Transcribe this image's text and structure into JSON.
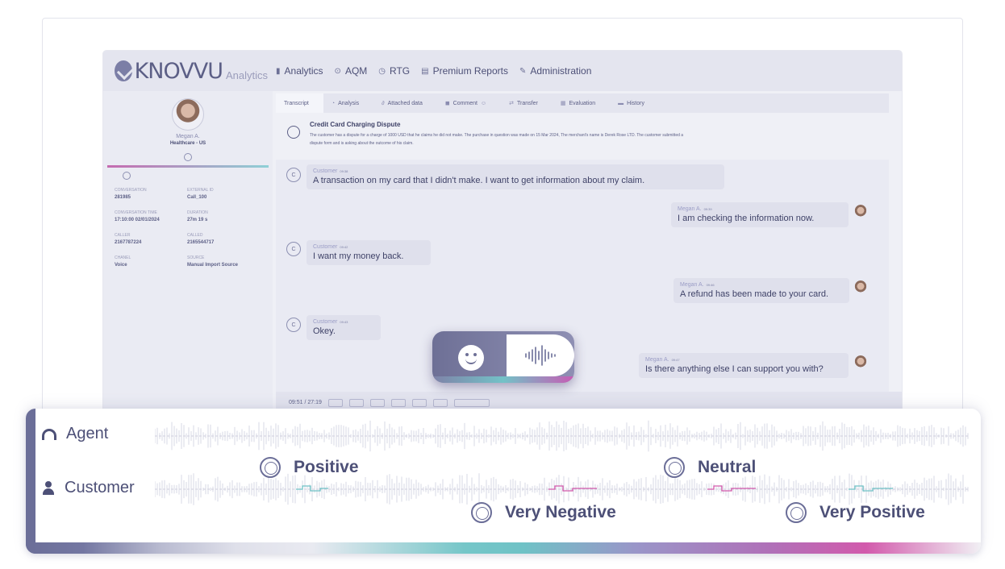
{
  "app": {
    "logo": "KNOVVU",
    "logo_sub": "Analytics",
    "nav": [
      {
        "label": "Analytics",
        "icon": "bar-chart-icon"
      },
      {
        "label": "AQM",
        "icon": "circle-check-icon"
      },
      {
        "label": "RTG",
        "icon": "clock-icon"
      },
      {
        "label": "Premium Reports",
        "icon": "document-icon"
      },
      {
        "label": "Administration",
        "icon": "tools-icon"
      }
    ]
  },
  "agent": {
    "name": "Megan A.",
    "team": "Healthcare - US"
  },
  "meta": [
    {
      "label": "CONVERSATION",
      "value": "281985"
    },
    {
      "label": "EXTERNAL ID",
      "value": "Call_100"
    },
    {
      "label": "CONVERSATION TIME",
      "value": "17:10:00 02/01/2024"
    },
    {
      "label": "DURATION",
      "value": "27m 19 s"
    },
    {
      "label": "CALLER",
      "value": "2167787224"
    },
    {
      "label": "CALLED",
      "value": "2165544717"
    },
    {
      "label": "CHANEL",
      "value": "Voice"
    },
    {
      "label": "SOURCE",
      "value": "Manual Import Source"
    }
  ],
  "tabs": [
    "Transcript",
    "Analysis",
    "Attached data",
    "Comment",
    "Transfer",
    "Evaluation",
    "History"
  ],
  "summary": {
    "title": "Credit Card Charging Dispute",
    "text": "The customer has a dispute for a charge of 1000 USD that he claims he did not make. The purchase in question was made on 15 Mar 2024, The merchant's name is Derek Rose LTD. The customer submitted a dispute form and is asking about the outcome of his claim."
  },
  "messages": [
    {
      "who": "Customer",
      "time": "09:38",
      "text": "A transaction on my card that I didn't make. I want to get information about my claim."
    },
    {
      "who": "Megan A.",
      "time": "09:39",
      "text": "I am checking the information now."
    },
    {
      "who": "Customer",
      "time": "09:42",
      "text": "I want my money back."
    },
    {
      "who": "Megan A.",
      "time": "09:46",
      "text": "A refund has been made to your card."
    },
    {
      "who": "Customer",
      "time": "09:43",
      "text": "Okey."
    },
    {
      "who": "Megan A.",
      "time": "09:47",
      "text": "Is there anything else I can support you with?"
    }
  ],
  "player": {
    "time": "09:51 / 27:19"
  },
  "tracks": {
    "agent_label": "Agent",
    "customer_label": "Customer"
  },
  "sentiments": [
    "Positive",
    "Very Negative",
    "Neutral",
    "Very Positive"
  ],
  "colors": {
    "accent": "#6b6e98",
    "teal": "#6fc2c6",
    "magenta": "#d25aac"
  }
}
